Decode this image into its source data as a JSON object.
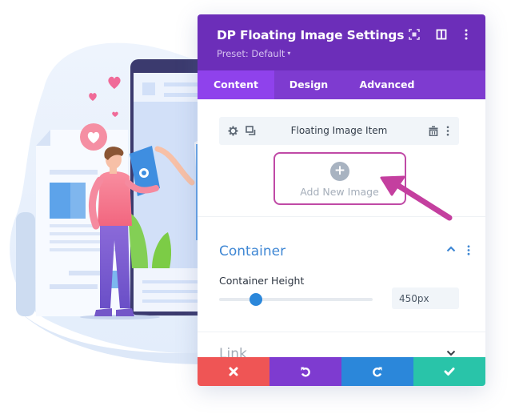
{
  "panel": {
    "title": "DP Floating Image Settings",
    "preset_label": "Preset: Default",
    "header_icons": [
      "focus-mode-icon",
      "split-view-icon",
      "more-options-icon"
    ],
    "tabs": [
      {
        "label": "Content",
        "active": true
      },
      {
        "label": "Design",
        "active": false
      },
      {
        "label": "Advanced",
        "active": false
      }
    ]
  },
  "content": {
    "item": {
      "label": "Floating Image Item",
      "icons": [
        "settings-icon",
        "duplicate-icon",
        "delete-icon",
        "more-options-icon"
      ]
    },
    "add_button": {
      "label": "Add New Image",
      "icon": "plus-icon"
    },
    "container_section": {
      "title": "Container",
      "expanded": true,
      "field_label": "Container Height",
      "slider_value_fraction": 0.24,
      "value": "450px"
    },
    "link_section": {
      "title": "Link",
      "expanded": false
    }
  },
  "footer": {
    "buttons": [
      {
        "name": "discard",
        "icon": "close-icon",
        "color": "#ef5555"
      },
      {
        "name": "undo",
        "icon": "undo-icon",
        "color": "#7e3bd0"
      },
      {
        "name": "redo",
        "icon": "redo-icon",
        "color": "#2b87da"
      },
      {
        "name": "save",
        "icon": "check-icon",
        "color": "#29c4a9"
      }
    ]
  },
  "colors": {
    "header": "#6c2eb9",
    "tabs": "#7e3bd0",
    "tab_active": "#8f42ec",
    "accent_blue": "#3f87d4",
    "highlight_magenta": "#c04aa6"
  }
}
